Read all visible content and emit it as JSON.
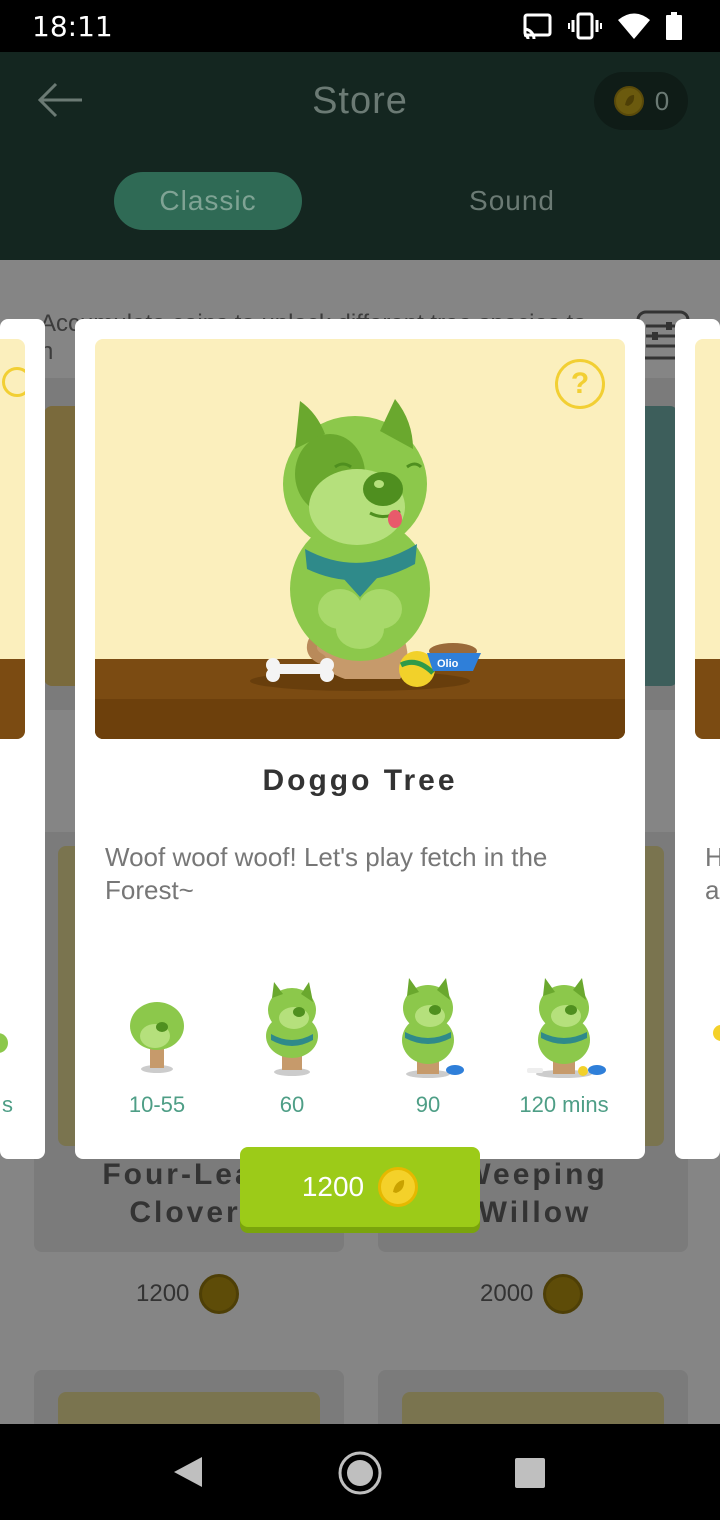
{
  "status_bar": {
    "time": "18:11",
    "icons": [
      "cast-icon",
      "vibrate-icon",
      "wifi-icon",
      "battery-icon"
    ]
  },
  "header": {
    "title": "Store",
    "coin_count": "0",
    "tabs": [
      {
        "label": "Classic",
        "active": true
      },
      {
        "label": "Sound",
        "active": false
      }
    ]
  },
  "background": {
    "info_text": "Accumulate coins to unlock different tree species to n",
    "cards": [
      {
        "name": "Four-Leaf Clover",
        "price": "1200"
      },
      {
        "name": "Weeping Willow",
        "price": "2000"
      }
    ],
    "partial_left_stage_label": "s",
    "partial_right_desc": "H a"
  },
  "modal": {
    "name": "Doggo Tree",
    "description": "Woof woof woof! Let's play fetch in the Forest~",
    "help_symbol": "?",
    "bowl_label": "Olio",
    "stages": [
      {
        "label": "10-55"
      },
      {
        "label": "60"
      },
      {
        "label": "90"
      },
      {
        "label": "120 mins"
      }
    ]
  },
  "purchase": {
    "price": "1200"
  },
  "colors": {
    "header_bg": "#142620",
    "accent_green": "#9ccb18",
    "stage_label": "#4e9e86",
    "coin_yellow": "#f4d12a",
    "help_yellow": "#f2cf33"
  }
}
